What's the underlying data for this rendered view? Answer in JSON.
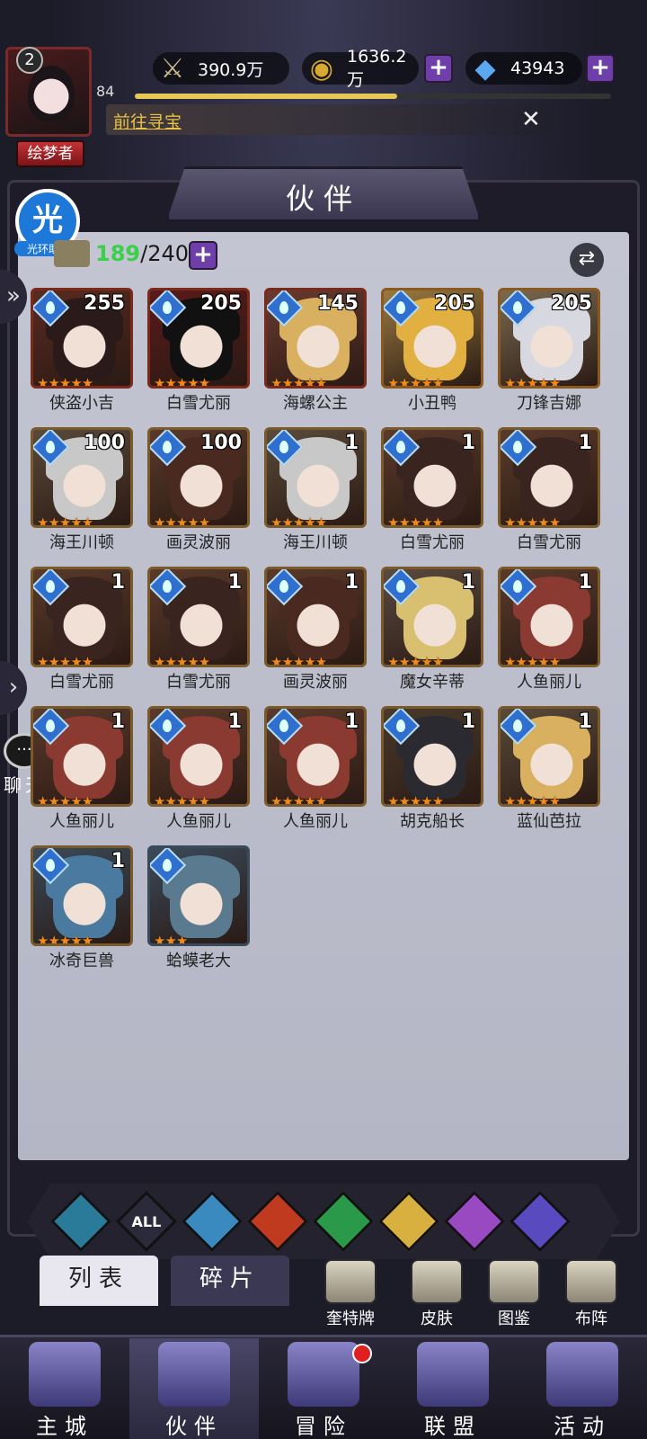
{
  "player": {
    "level": "2",
    "exp_level": "84",
    "title": "绘梦者"
  },
  "resources": {
    "power": "390.9万",
    "gold": "1636.2万",
    "diamonds": "43943",
    "plus": "+"
  },
  "quest": {
    "text": "前往寻宝",
    "close": "✕"
  },
  "panel": {
    "title": "伙伴"
  },
  "helper": {
    "icon_text": "光",
    "label": "光环助手"
  },
  "count": {
    "current": "189",
    "max": "/240"
  },
  "chat": {
    "label": "聊天",
    "icon": "···"
  },
  "heroes": [
    {
      "name": "侠盗小吉",
      "level": "255",
      "stars": 5,
      "frame": "#7a2a1a",
      "bg": "#5a2a20",
      "hair": "#2a1a1a"
    },
    {
      "name": "白雪尤丽",
      "level": "205",
      "stars": 5,
      "frame": "#7a2a1a",
      "bg": "#5a1a1a",
      "hair": "#111"
    },
    {
      "name": "海螺公主",
      "level": "145",
      "stars": 5,
      "frame": "#7a2a1a",
      "bg": "#6a3a30",
      "hair": "#d8b060"
    },
    {
      "name": "小丑鸭",
      "level": "205",
      "stars": 5,
      "frame": "#8a5a20",
      "bg": "#9a7a40",
      "hair": "#e2b040"
    },
    {
      "name": "刀锋吉娜",
      "level": "205",
      "stars": 5,
      "frame": "#8a5a20",
      "bg": "#7a6a50",
      "hair": "#d8d8e0"
    },
    {
      "name": "海王川顿",
      "level": "100",
      "stars": 5,
      "frame": "#7a5a2a",
      "bg": "#5a4a3a",
      "hair": "#c8c8c8"
    },
    {
      "name": "画灵波丽",
      "level": "100",
      "stars": 5,
      "frame": "#7a5a2a",
      "bg": "#5a3a2a",
      "hair": "#4a2a20"
    },
    {
      "name": "海王川顿",
      "level": "1",
      "stars": 5,
      "frame": "#7a5a2a",
      "bg": "#5a4a3a",
      "hair": "#c8c8c8"
    },
    {
      "name": "白雪尤丽",
      "level": "1",
      "stars": 5,
      "frame": "#7a5a2a",
      "bg": "#5a3a2a",
      "hair": "#3a2420"
    },
    {
      "name": "白雪尤丽",
      "level": "1",
      "stars": 5,
      "frame": "#7a5a2a",
      "bg": "#5a3a2a",
      "hair": "#3a2420"
    },
    {
      "name": "白雪尤丽",
      "level": "1",
      "stars": 5,
      "frame": "#7a5a2a",
      "bg": "#5a3a2a",
      "hair": "#3a2420"
    },
    {
      "name": "白雪尤丽",
      "level": "1",
      "stars": 5,
      "frame": "#7a5a2a",
      "bg": "#5a3a2a",
      "hair": "#3a2420"
    },
    {
      "name": "画灵波丽",
      "level": "1",
      "stars": 5,
      "frame": "#7a5a2a",
      "bg": "#5a3a2a",
      "hair": "#4a2a20"
    },
    {
      "name": "魔女辛蒂",
      "level": "1",
      "stars": 5,
      "frame": "#7a5a2a",
      "bg": "#5a4a40",
      "hair": "#d8c070"
    },
    {
      "name": "人鱼丽儿",
      "level": "1",
      "stars": 5,
      "frame": "#7a5a2a",
      "bg": "#5a3a2a",
      "hair": "#8a3a30"
    },
    {
      "name": "人鱼丽儿",
      "level": "1",
      "stars": 5,
      "frame": "#7a5a2a",
      "bg": "#5a3a2a",
      "hair": "#8a3a30"
    },
    {
      "name": "人鱼丽儿",
      "level": "1",
      "stars": 5,
      "frame": "#7a5a2a",
      "bg": "#5a3a2a",
      "hair": "#8a3a30"
    },
    {
      "name": "人鱼丽儿",
      "level": "1",
      "stars": 5,
      "frame": "#7a5a2a",
      "bg": "#5a3a2a",
      "hair": "#8a3a30"
    },
    {
      "name": "胡克船长",
      "level": "1",
      "stars": 5,
      "frame": "#7a5a2a",
      "bg": "#4a3a2a",
      "hair": "#2a2a30"
    },
    {
      "name": "蓝仙芭拉",
      "level": "1",
      "stars": 5,
      "frame": "#7a5a2a",
      "bg": "#5a4a3a",
      "hair": "#d8b060"
    },
    {
      "name": "冰奇巨兽",
      "level": "1",
      "stars": 5,
      "frame": "#7a5a2a",
      "bg": "#3a4a5a",
      "hair": "#4a7aa0"
    },
    {
      "name": "蛤蟆老大",
      "level": "",
      "stars": 3,
      "frame": "#3a4a5a",
      "bg": "#3a4a5a",
      "hair": "#5a7a90"
    }
  ],
  "filters": [
    {
      "label": "",
      "color": "#2a7a9a"
    },
    {
      "label": "ALL",
      "color": "#2a2a3a"
    },
    {
      "label": "",
      "color": "#3a8ac0"
    },
    {
      "label": "",
      "color": "#c03a20"
    },
    {
      "label": "",
      "color": "#2a9a4a"
    },
    {
      "label": "",
      "color": "#d8b040"
    },
    {
      "label": "",
      "color": "#9a4ac0"
    },
    {
      "label": "",
      "color": "#5a4ac0"
    }
  ],
  "sub_tabs": {
    "list": "列表",
    "fragments": "碎片"
  },
  "tools": [
    {
      "label": "奎特牌"
    },
    {
      "label": "皮肤"
    },
    {
      "label": "图鉴"
    },
    {
      "label": "布阵"
    }
  ],
  "nav": [
    {
      "label": "主城"
    },
    {
      "label": "伙伴"
    },
    {
      "label": "冒险"
    },
    {
      "label": "联盟"
    },
    {
      "label": "活动"
    }
  ],
  "colors": {
    "accent_green": "#3bd04a",
    "star": "#f08a1c",
    "gold_text": "#e6c245",
    "plus_purple": "#6e3fa8"
  }
}
